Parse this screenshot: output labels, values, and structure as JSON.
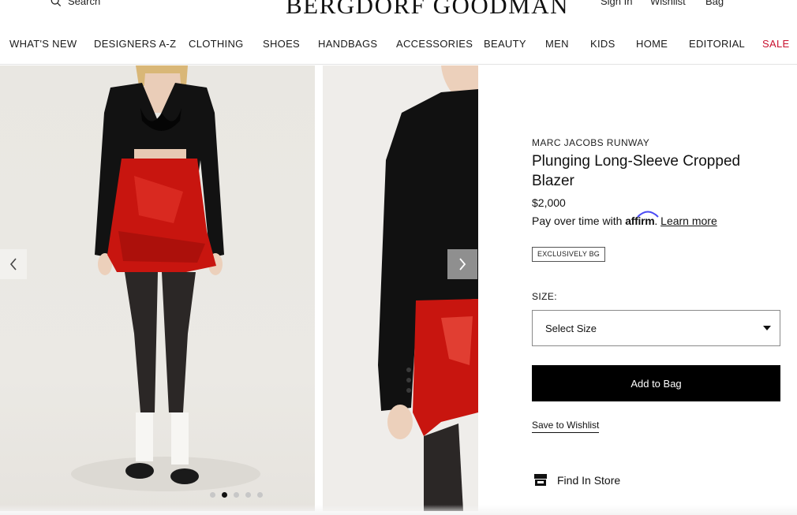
{
  "header": {
    "search_label": "Search",
    "logo_text": "BERGDORF GOODMAN",
    "sign_in": "Sign In",
    "wishlist": "Wishlist",
    "bag": "Bag"
  },
  "nav": {
    "items": [
      "WHAT'S NEW",
      "DESIGNERS A-Z",
      "CLOTHING",
      "SHOES",
      "HANDBAGS",
      "ACCESSORIES",
      "BEAUTY",
      "MEN",
      "KIDS",
      "HOME",
      "EDITORIAL",
      "SALE"
    ],
    "sale_color": "#c8102e"
  },
  "gallery": {
    "dots_total": 5,
    "active_dot": 1
  },
  "product": {
    "brand": "MARC JACOBS RUNWAY",
    "title": "Plunging Long-Sleeve Cropped Blazer",
    "price": "$2,000",
    "affirm_prefix": "Pay over time with ",
    "affirm_logo": "affirm",
    "affirm_link": "Learn more",
    "badge": "EXCLUSIVELY BG",
    "size_label": "SIZE:",
    "size_placeholder": "Select Size",
    "add_to_bag": "Add to Bag",
    "save_to_wishlist": "Save to Wishlist",
    "find_in_store": "Find In Store"
  },
  "colors": {
    "accent_black": "#000000",
    "affirm_blue": "#4a4af4"
  },
  "icons": [
    "search-icon",
    "chevron-left-icon",
    "chevron-right-icon",
    "store-icon",
    "caret-down-icon"
  ]
}
